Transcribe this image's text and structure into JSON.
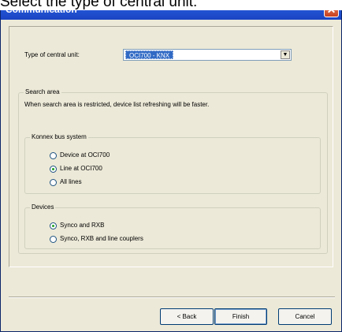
{
  "caption": "Select the type of central unit:",
  "window": {
    "title": "Communication",
    "close_symbol": "✕"
  },
  "central_unit": {
    "label": "Type of central unit:",
    "value": "OCI700 - KNX"
  },
  "search_area": {
    "title": "Search area",
    "description": "When search area is restricted, device list refreshing will be faster."
  },
  "konnex": {
    "title": "Konnex bus system",
    "options": [
      {
        "label": "Device at OCI700",
        "selected": false
      },
      {
        "label": "Line at OCI700",
        "selected": true
      },
      {
        "label": "All lines",
        "selected": false
      }
    ]
  },
  "devices": {
    "title": "Devices",
    "options": [
      {
        "label": "Synco and RXB",
        "selected": true
      },
      {
        "label": "Synco, RXB and line couplers",
        "selected": false
      }
    ]
  },
  "buttons": {
    "back": "< Back",
    "finish": "Finish",
    "cancel": "Cancel"
  }
}
